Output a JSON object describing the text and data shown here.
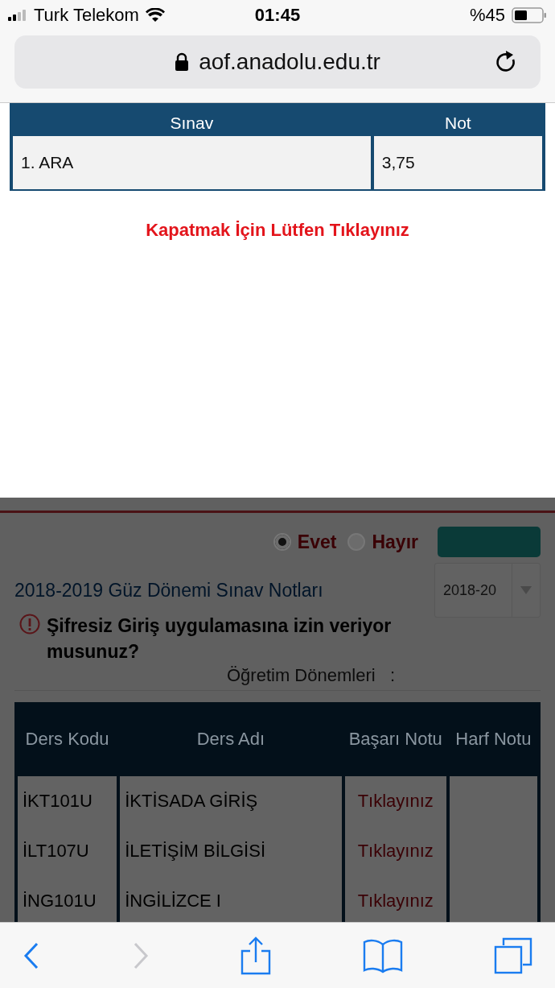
{
  "status_bar": {
    "carrier": "Turk Telekom",
    "time": "01:45",
    "battery": "%45"
  },
  "address_bar": {
    "url": "aof.anadolu.edu.tr"
  },
  "modal": {
    "table": {
      "columns": [
        "Sınav",
        "Not"
      ],
      "rows": [
        [
          "1. ARA",
          "3,75"
        ]
      ]
    },
    "close_link": "Kapatmak İçin Lütfen Tıklayınız"
  },
  "page": {
    "radios": [
      {
        "label": "Evet",
        "selected": true
      },
      {
        "label": "Hayır",
        "selected": false
      }
    ],
    "title": "2018-2019 Güz Dönemi Sınav Notları",
    "term_select": {
      "value": "2018-20"
    },
    "warning": "Şifresiz Giriş uygulamasına izin veriyor musunuz?",
    "term_label": "Öğretim Dönemleri   :",
    "table": {
      "columns": [
        "Ders Kodu",
        "Ders Adı",
        "Başarı Notu",
        "Harf Notu"
      ],
      "rows": [
        {
          "code": "İKT101U",
          "name": "İKTİSADA GİRİŞ",
          "grade_link": "Tıklayınız"
        },
        {
          "code": "İLT107U",
          "name": "İLETİŞİM BİLGİSİ",
          "grade_link": "Tıklayınız"
        },
        {
          "code": "İNG101U",
          "name": "İNGİLİZCE I",
          "grade_link": "Tıklayınız"
        }
      ]
    }
  },
  "toolbar": {
    "buttons": [
      {
        "kind": "back",
        "disabled": false
      },
      {
        "kind": "forward",
        "disabled": true
      },
      {
        "kind": "share",
        "disabled": false
      },
      {
        "kind": "bookmarks",
        "disabled": false
      },
      {
        "kind": "tabs",
        "disabled": false
      }
    ]
  }
}
